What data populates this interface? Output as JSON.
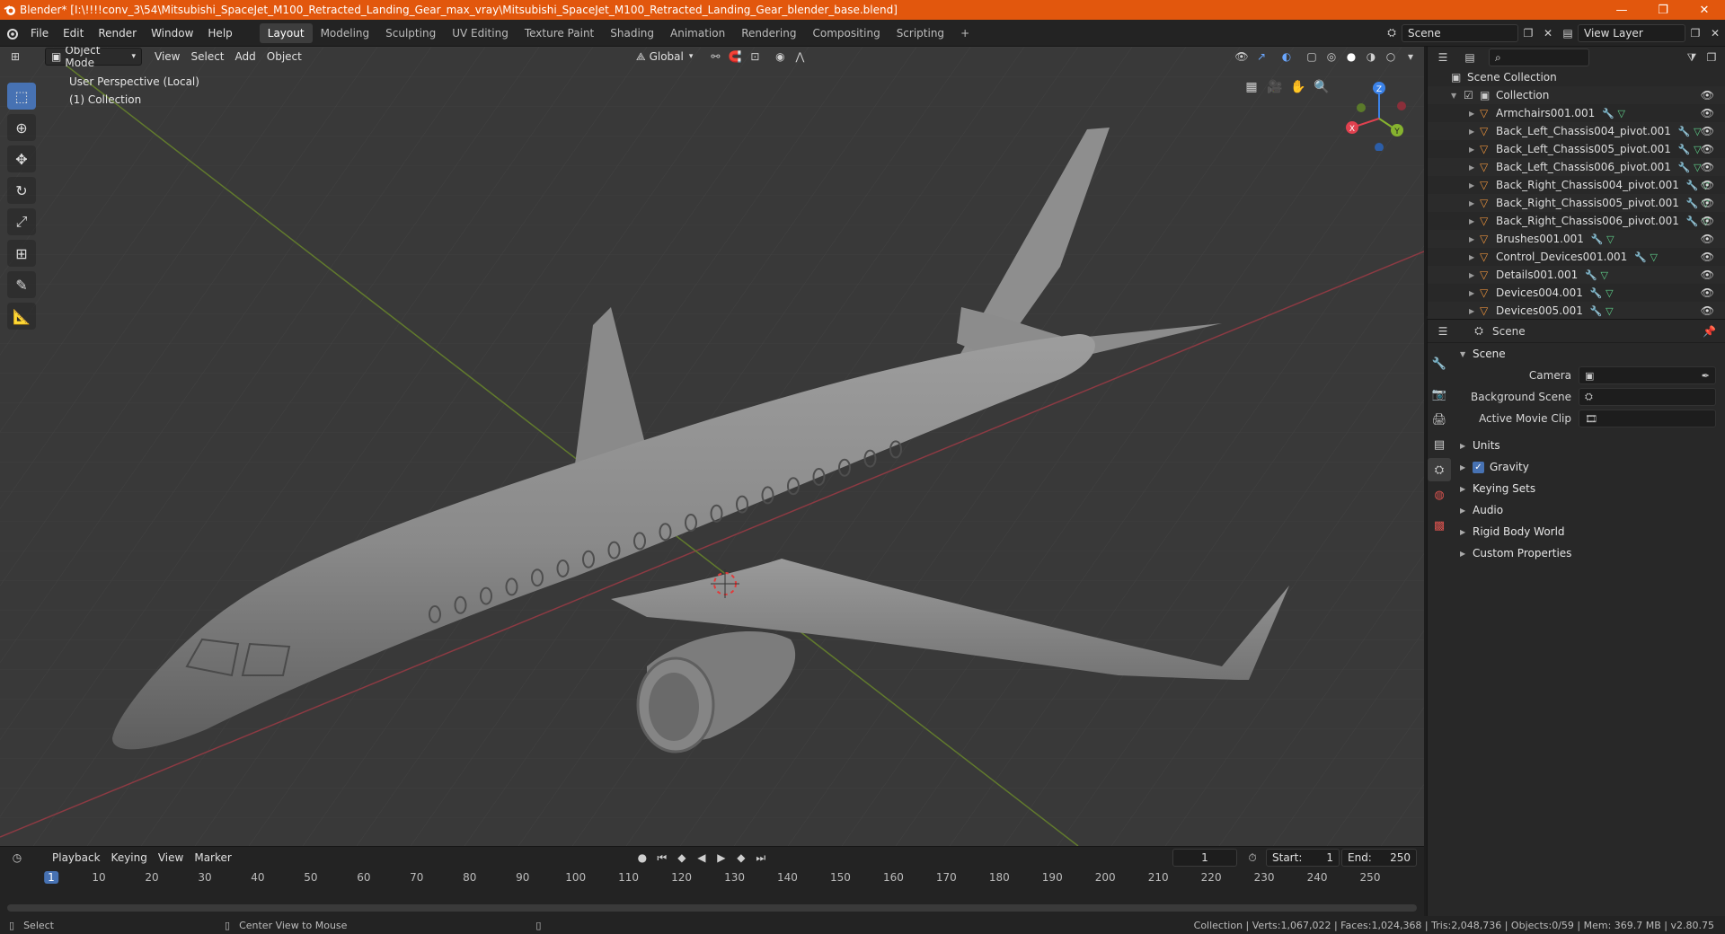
{
  "titlebar": {
    "title": "Blender* [I:\\!!!!conv_3\\54\\Mitsubishi_SpaceJet_M100_Retracted_Landing_Gear_max_vray\\Mitsubishi_SpaceJet_M100_Retracted_Landing_Gear_blender_base.blend]",
    "minimize": "—",
    "maximize": "❐",
    "close": "✕"
  },
  "menus": [
    "File",
    "Edit",
    "Render",
    "Window",
    "Help"
  ],
  "workspaces": [
    "Layout",
    "Modeling",
    "Sculpting",
    "UV Editing",
    "Texture Paint",
    "Shading",
    "Animation",
    "Rendering",
    "Compositing",
    "Scripting"
  ],
  "workspace_add": "+",
  "scene_selector": {
    "value": "Scene"
  },
  "view_layer_selector": {
    "value": "View Layer"
  },
  "viewport": {
    "mode": "Object Mode",
    "menus": [
      "View",
      "Select",
      "Add",
      "Object"
    ],
    "transform_orientation": "Global",
    "perspective_label": "User Perspective (Local)",
    "collection_label": "(1) Collection",
    "gizmo": {
      "x": "X",
      "y": "Y",
      "z": "Z"
    }
  },
  "timeline": {
    "menus": [
      "Playback",
      "Keying",
      "View",
      "Marker"
    ],
    "current_frame": "1",
    "start_label": "Start:",
    "start": "1",
    "end_label": "End:",
    "end": "250",
    "ticks": [
      "1",
      "10",
      "20",
      "30",
      "40",
      "50",
      "60",
      "70",
      "80",
      "90",
      "100",
      "110",
      "120",
      "130",
      "140",
      "150",
      "160",
      "170",
      "180",
      "190",
      "200",
      "210",
      "220",
      "230",
      "240",
      "250"
    ]
  },
  "statusbar": {
    "left_action": "Select",
    "mid_action": "Center View to Mouse",
    "stats": "Collection | Verts:1,067,022 | Faces:1,024,368 | Tris:2,048,736 | Objects:0/59 | Mem: 369.7 MB | v2.80.75"
  },
  "outliner": {
    "root": "Scene Collection",
    "collection": "Collection",
    "items": [
      "Armchairs001.001",
      "Back_Left_Chassis004_pivot.001",
      "Back_Left_Chassis005_pivot.001",
      "Back_Left_Chassis006_pivot.001",
      "Back_Right_Chassis004_pivot.001",
      "Back_Right_Chassis005_pivot.001",
      "Back_Right_Chassis006_pivot.001",
      "Brushes001.001",
      "Control_Devices001.001",
      "Details001.001",
      "Devices004.001",
      "Devices005.001"
    ]
  },
  "properties": {
    "header": "Scene",
    "section_scene": "Scene",
    "camera_label": "Camera",
    "background_scene_label": "Background Scene",
    "active_movie_clip_label": "Active Movie Clip",
    "sections": [
      "Units",
      "Gravity",
      "Keying Sets",
      "Audio",
      "Rigid Body World",
      "Custom Properties"
    ]
  },
  "colors": {
    "title_bg": "#e2570d",
    "accent": "#4772b3",
    "viewport_bg": "#393939",
    "axis_x": "#e0414f",
    "axis_y": "#86b32f",
    "axis_z": "#3b82e8"
  }
}
